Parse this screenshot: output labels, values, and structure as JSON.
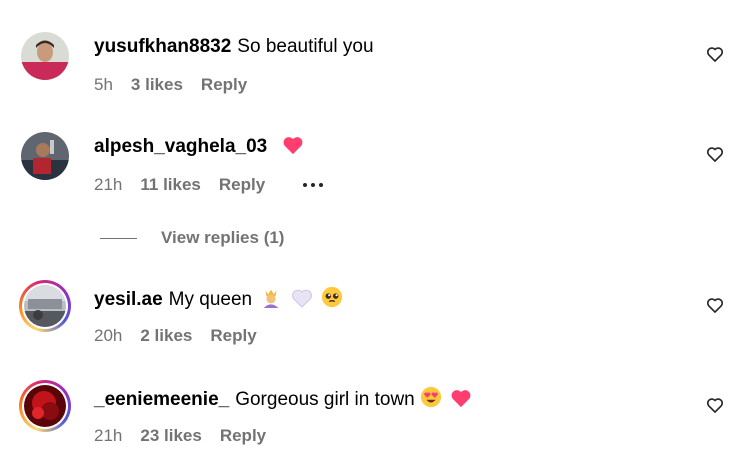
{
  "comments": [
    {
      "username": "yusufkhan8832",
      "text": "So beautiful you",
      "time": "5h",
      "likes": "3 likes",
      "reply": "Reply",
      "avatar_ring": false,
      "emojis": []
    },
    {
      "username": "alpesh_vaghela_03",
      "text": "",
      "time": "21h",
      "likes": "11 likes",
      "reply": "Reply",
      "avatar_ring": false,
      "emojis": [
        "pink-heart"
      ],
      "show_more": true
    },
    {
      "username": "yesil.ae",
      "text": "My queen",
      "time": "20h",
      "likes": "2 likes",
      "reply": "Reply",
      "avatar_ring": true,
      "emojis": [
        "princess",
        "white-heart",
        "pleading-face"
      ]
    },
    {
      "username": "_eeniemeenie_",
      "text": "Gorgeous girl in town",
      "time": "21h",
      "likes": "23 likes",
      "reply": "Reply",
      "avatar_ring": true,
      "emojis": [
        "heart-eyes-face",
        "pink-heart"
      ]
    }
  ],
  "view_replies": "View replies (1)",
  "colors": {
    "meta": "#737373",
    "heart_pink": "#ff3d6e",
    "ring_start": "#feda75",
    "ring_end": "#962fbf"
  }
}
